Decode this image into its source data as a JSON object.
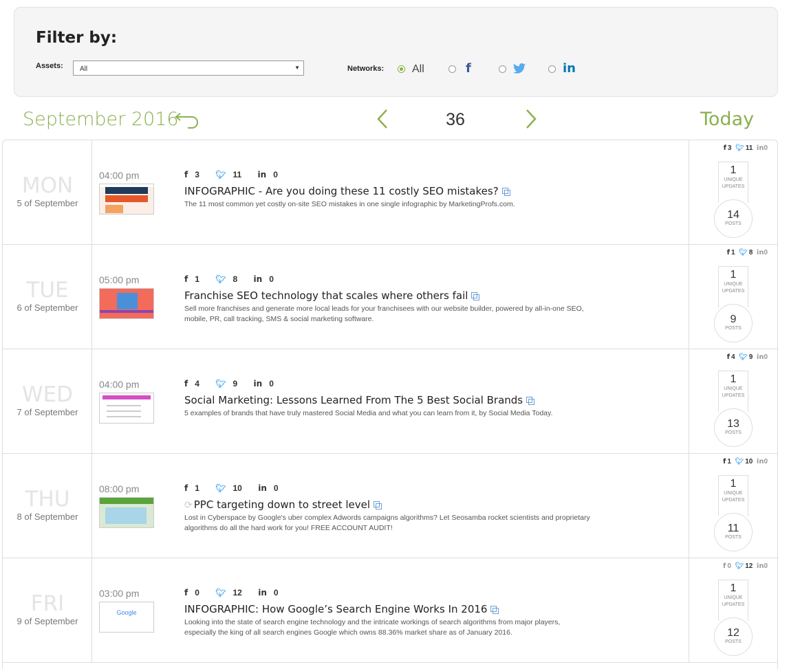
{
  "filter": {
    "title": "Filter by:",
    "assets_label": "Assets:",
    "assets_value": "All",
    "networks_label": "Networks:",
    "network_all_label": "All",
    "selected_network": "All"
  },
  "calendar": {
    "month": "September 2016",
    "week_number": "36",
    "today_label": "Today"
  },
  "colors": {
    "accent": "#8cb04f",
    "twitter": "#55acee",
    "linkedin": "#0077b5",
    "facebook": "#3b5998"
  },
  "rows": [
    {
      "day": "MON",
      "date": "5 of September",
      "time": "04:00 pm",
      "fb": "3",
      "tw": "11",
      "li": "0",
      "title": "INFOGRAPHIC - Are you doing these 11 costly SEO mistakes?",
      "desc": "The 11 most common yet costly on-site SEO mistakes in one single infographic by MarketingProfs.com.",
      "side_fb": "3",
      "side_tw": "11",
      "side_li": "0",
      "unique": "1",
      "unique_label1": "UNIQUE",
      "unique_label2": "UPDATES",
      "posts": "14",
      "posts_label": "POSTS"
    },
    {
      "day": "TUE",
      "date": "6 of September",
      "time": "05:00 pm",
      "fb": "1",
      "tw": "8",
      "li": "0",
      "title": "Franchise SEO technology that scales where others fail",
      "desc": "Sell more franchises and generate more local leads for your franchisees with our website builder, powered by all-in-one SEO, mobile, PR, call tracking, SMS & social marketing software.",
      "side_fb": "1",
      "side_tw": "8",
      "side_li": "0",
      "unique": "1",
      "unique_label1": "UNIQUE",
      "unique_label2": "UPDATES",
      "posts": "9",
      "posts_label": "POSTS"
    },
    {
      "day": "WED",
      "date": "7 of September",
      "time": "04:00 pm",
      "fb": "4",
      "tw": "9",
      "li": "0",
      "title": "Social Marketing: Lessons Learned From The 5 Best Social Brands",
      "desc": "5 examples of brands that have truly mastered Social Media and what you can learn from it, by Social Media Today.",
      "side_fb": "4",
      "side_tw": "9",
      "side_li": "0",
      "unique": "1",
      "unique_label1": "UNIQUE",
      "unique_label2": "UPDATES",
      "posts": "13",
      "posts_label": "POSTS"
    },
    {
      "day": "THU",
      "date": "8 of September",
      "time": "08:00 pm",
      "fb": "1",
      "tw": "10",
      "li": "0",
      "title": "PPC targeting down to street level",
      "desc": "Lost in Cyberspace by Google's uber complex Adwords campaigns algorithms? Let Seosamba rocket scientists and proprietary algorithms do all the hard work for you! FREE ACCOUNT AUDIT!",
      "side_fb": "1",
      "side_tw": "10",
      "side_li": "0",
      "unique": "1",
      "unique_label1": "UNIQUE",
      "unique_label2": "UPDATES",
      "posts": "11",
      "posts_label": "POSTS"
    },
    {
      "day": "FRI",
      "date": "9 of September",
      "time": "03:00 pm",
      "fb": "0",
      "tw": "12",
      "li": "0",
      "title": "INFOGRAPHIC: How Google’s Search Engine Works In 2016",
      "desc": "Looking into the state of search engine technology and the intricate workings of search algorithms from major players, especially the king of all search engines Google which owns  88.36% market share as of January 2016.",
      "side_fb": "0",
      "side_tw": "12",
      "side_li": "0",
      "unique": "1",
      "unique_label1": "UNIQUE",
      "unique_label2": "UPDATES",
      "posts": "12",
      "posts_label": "POSTS"
    }
  ]
}
